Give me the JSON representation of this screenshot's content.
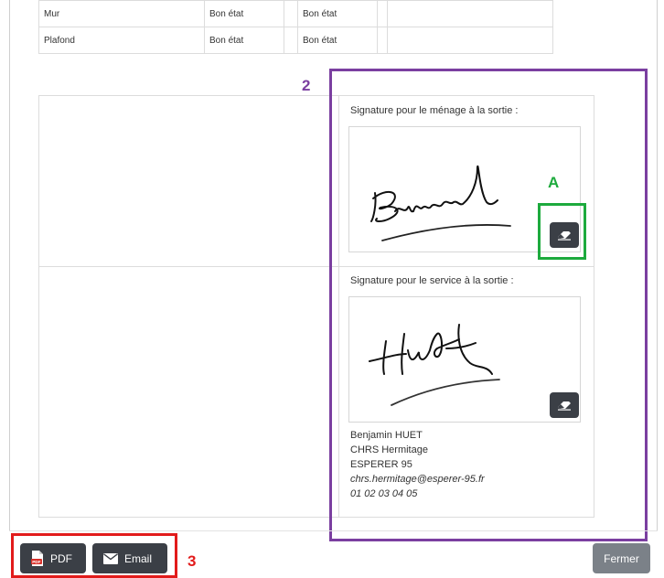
{
  "inventory_table": {
    "rows": [
      {
        "element": "Mur",
        "entry_state": "Bon état",
        "exit_state": "Bon état"
      },
      {
        "element": "Plafond",
        "entry_state": "Bon état",
        "exit_state": "Bon état"
      }
    ]
  },
  "signatures": {
    "cleaning": {
      "label": "Signature pour le ménage à la sortie :",
      "signed": true
    },
    "service": {
      "label": "Signature pour le service à la sortie :",
      "signed": true
    }
  },
  "contact": {
    "name": "Benjamin HUET",
    "org": "CHRS Hermitage",
    "association": "ESPERER 95",
    "email": "chrs.hermitage@esperer-95.fr",
    "phone": "01 02 03 04 05"
  },
  "footer": {
    "pdf_label": "PDF",
    "email_label": "Email",
    "close_label": "Fermer"
  },
  "annotations": {
    "purple": "2",
    "green": "A",
    "red": "3"
  },
  "colors": {
    "button_dark": "#3b3f46",
    "button_close": "#7b8188",
    "annotation_purple": "#7b3fa0",
    "annotation_green": "#1daa3d",
    "annotation_red": "#e21b1b"
  },
  "icons": {
    "eraser": "eraser-icon",
    "pdf": "pdf-file-icon",
    "email": "envelope-icon"
  }
}
